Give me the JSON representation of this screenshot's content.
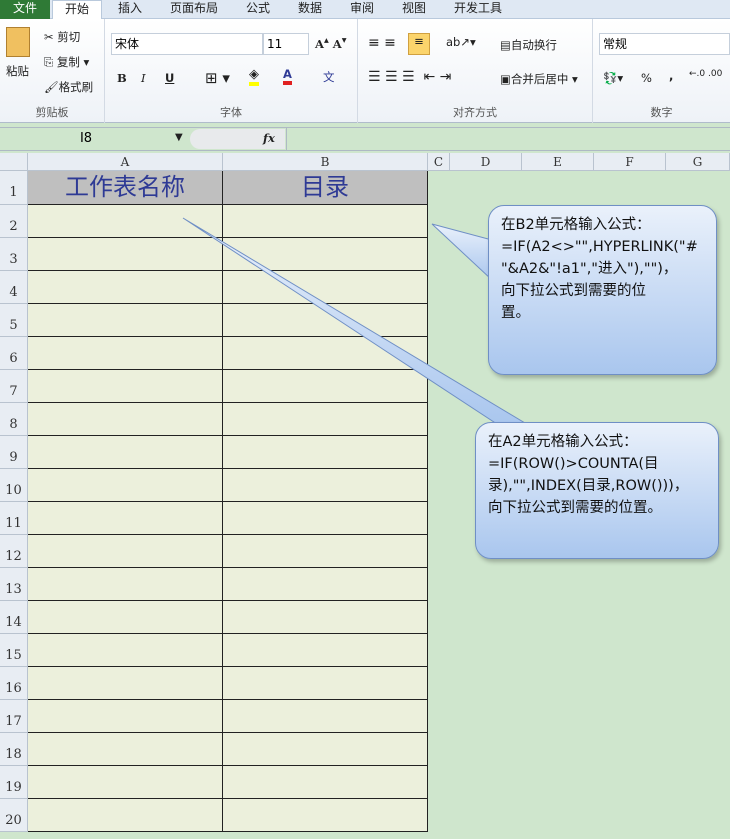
{
  "tabs": [
    "文件",
    "开始",
    "插入",
    "页面布局",
    "公式",
    "数据",
    "审阅",
    "视图",
    "开发工具"
  ],
  "clipboard": {
    "paste": "粘贴",
    "cut": "剪切",
    "copy": "复制",
    "format_painter": "格式刷",
    "label": "剪贴板"
  },
  "font": {
    "name": "宋体",
    "size": "11",
    "label": "字体",
    "bold": "B",
    "italic": "I",
    "underline": "U",
    "fill_color": "#ffff00",
    "font_color": "#e02020"
  },
  "alignment": {
    "wrap": "自动换行",
    "merge": "合并后居中",
    "label": "对齐方式"
  },
  "number": {
    "format": "常规",
    "percent": "%",
    "comma": ",",
    "label": "数字"
  },
  "formula_bar": {
    "name_box": "I8",
    "fx": "fx",
    "value": ""
  },
  "columns": [
    "A",
    "B",
    "C",
    "D",
    "E",
    "F",
    "G"
  ],
  "rows": [
    "1",
    "2",
    "3",
    "4",
    "5",
    "6",
    "7",
    "8",
    "9",
    "10",
    "11",
    "12",
    "13",
    "14",
    "15",
    "16",
    "17",
    "18",
    "19",
    "20"
  ],
  "cells": {
    "A1": "工作表名称",
    "B1": "目录"
  },
  "callouts": [
    {
      "text": "在B2单元格输入公式：\n=IF(A2<>\"\",HYPERLINK(\"#\n\"&A2&\"!a1\",\"进入\"),\"\")，\n向下拉公式到需要的位\n置。"
    },
    {
      "text": "在A2单元格输入公式：\n=IF(ROW()>COUNTA(目\n录),\"\",INDEX(目录,ROW()))，\n向下拉公式到需要的位置。"
    }
  ]
}
